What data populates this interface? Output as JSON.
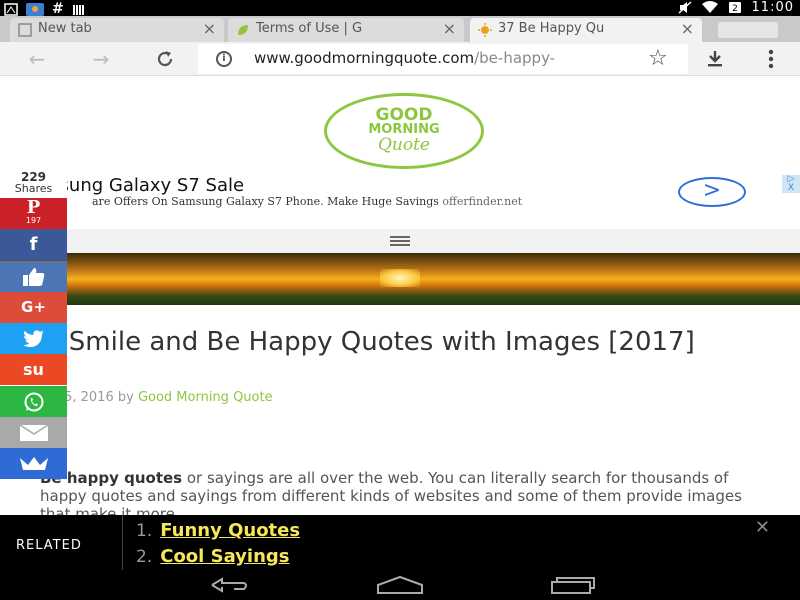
{
  "status_bar": {
    "time": "11:00",
    "left_icons": [
      "notification-icon",
      "photo-icon",
      "hash-icon",
      "signal-bars-icon"
    ],
    "right_icons": [
      "mute-icon",
      "wifi-icon",
      "battery-icon"
    ]
  },
  "tabs": [
    {
      "title": "New tab",
      "active": false
    },
    {
      "title": "Terms of Use | G",
      "active": false
    },
    {
      "title": "37 Be Happy Qu",
      "active": true
    }
  ],
  "toolbar": {
    "url_host": "www.goodmorningquote.com",
    "url_path": "/be-happy-"
  },
  "logo": {
    "line1": "GOOD",
    "line2": "MORNING",
    "line3": "Quote"
  },
  "ad": {
    "title": "msung Galaxy S7 Sale",
    "description": "are Offers On Samsung Galaxy S7 Phone. Make Huge Savings",
    "source": "offerfinder.net"
  },
  "article": {
    "title": "7 Smile and Be Happy Quotes with Images [2017]",
    "date": "y 15, 2016 by",
    "author": "Good Morning Quote",
    "intro_bold": "Be happy quotes",
    "intro_rest": " or sayings are all over the web. You can literally search for thousands of happy quotes and sayings from different kinds of websites and some of them provide images that make it more"
  },
  "share": {
    "total": "229",
    "total_label": "Shares",
    "pinterest_count": "197",
    "buttons": [
      {
        "name": "pinterest",
        "color": "#cb2027"
      },
      {
        "name": "facebook",
        "color": "#3b5998"
      },
      {
        "name": "like",
        "color": "#4d76b6"
      },
      {
        "name": "google-plus",
        "color": "#dd4b39"
      },
      {
        "name": "twitter",
        "color": "#1da1f2"
      },
      {
        "name": "stumbleupon",
        "color": "#eb4924"
      },
      {
        "name": "whatsapp",
        "color": "#2bb741"
      },
      {
        "name": "email",
        "color": "#a9a9a9"
      },
      {
        "name": "sumo-crown",
        "color": "#2e6bd4"
      }
    ],
    "pinterest_glyph": "P",
    "facebook_glyph": "f",
    "google_glyph": "G+",
    "stumble_glyph": "su"
  },
  "related": {
    "label": "RELATED",
    "items": [
      {
        "num": "1.",
        "title": "Funny Quotes"
      },
      {
        "num": "2.",
        "title": "Cool Sayings"
      }
    ]
  },
  "colors": {
    "brand_green": "#8dc63f",
    "link_yellow": "#f6e75a",
    "ad_blue": "#2d6fd6"
  }
}
